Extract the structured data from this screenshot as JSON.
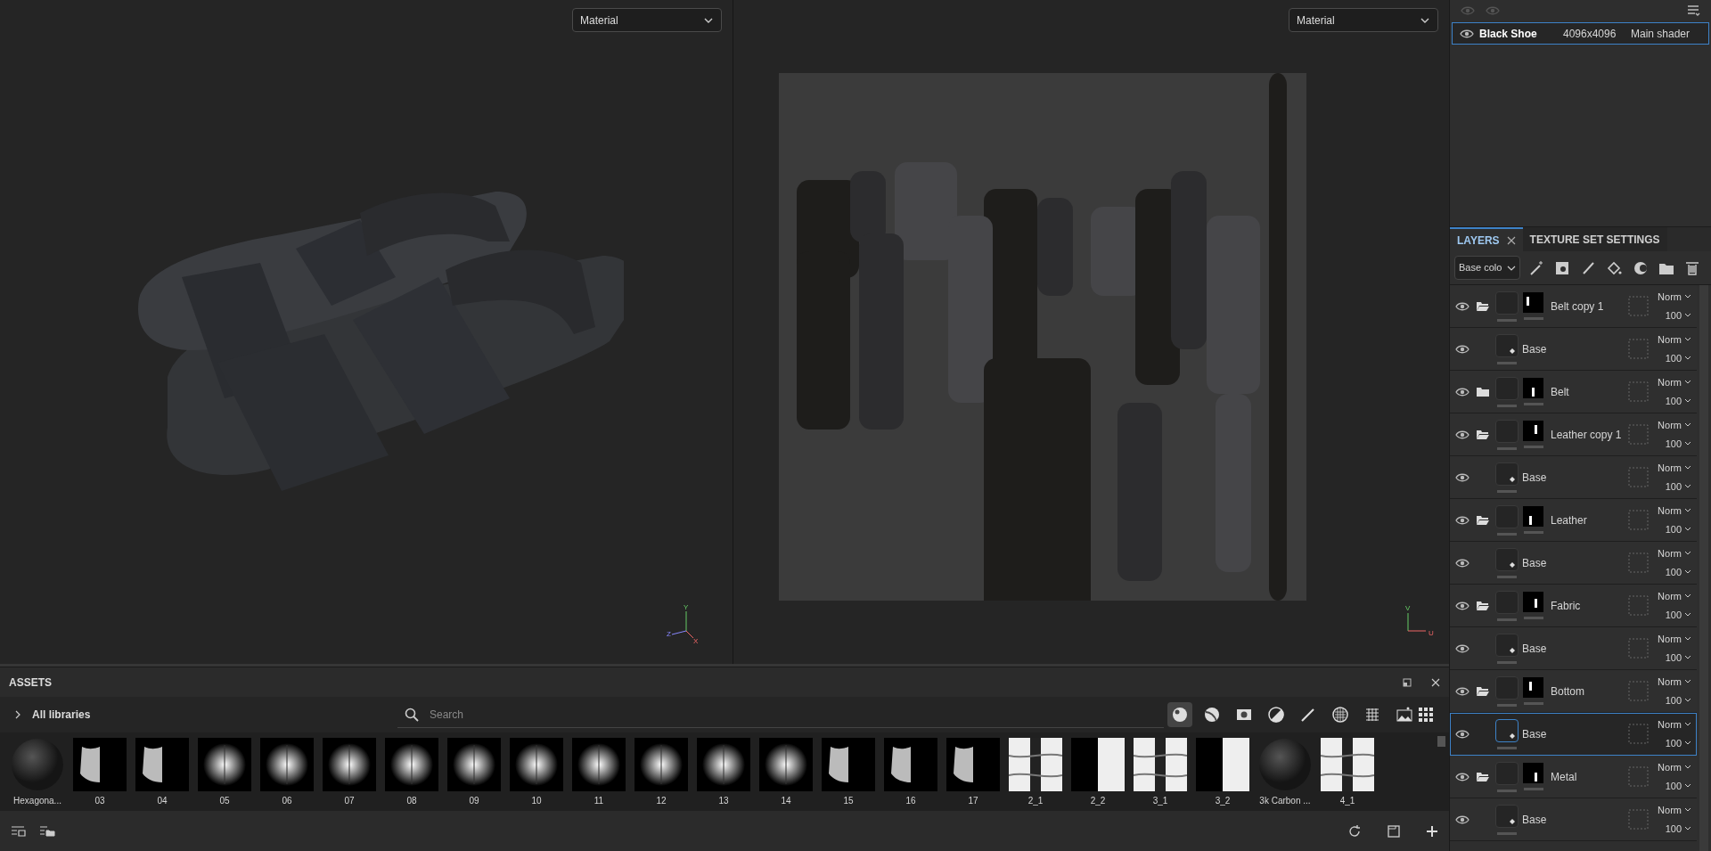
{
  "viewports": [
    {
      "dropdown": "Material",
      "gizmo": [
        "Y",
        "Z",
        "X"
      ]
    },
    {
      "dropdown": "Material",
      "gizmo": [
        "V",
        "U"
      ]
    }
  ],
  "texture_sets": [
    {
      "name": "Black Shoe",
      "resolution": "4096x4096",
      "shader": "Main shader",
      "selected": true,
      "visible": true
    }
  ],
  "tabs": [
    {
      "label": "LAYERS",
      "selected": true,
      "closable": true
    },
    {
      "label": "TEXTURE SET SETTINGS",
      "selected": false,
      "closable": false
    }
  ],
  "channel_dropdown": "Base colo",
  "layers": [
    {
      "name": "Belt copy 1",
      "kind": "folder",
      "expanded": true,
      "selected": false,
      "visible": true,
      "blend": "Norm",
      "opacity": "100"
    },
    {
      "name": "Base",
      "kind": "fill",
      "selected": false,
      "visible": true,
      "blend": "Norm",
      "opacity": "100"
    },
    {
      "name": "Belt",
      "kind": "folder",
      "expanded": false,
      "selected": false,
      "visible": true,
      "blend": "Norm",
      "opacity": "100"
    },
    {
      "name": "Leather copy 1",
      "kind": "folder",
      "expanded": true,
      "selected": false,
      "visible": true,
      "blend": "Norm",
      "opacity": "100"
    },
    {
      "name": "Base",
      "kind": "fill",
      "selected": false,
      "visible": true,
      "blend": "Norm",
      "opacity": "100"
    },
    {
      "name": "Leather",
      "kind": "folder",
      "expanded": true,
      "selected": false,
      "visible": true,
      "blend": "Norm",
      "opacity": "100"
    },
    {
      "name": "Base",
      "kind": "fill",
      "selected": false,
      "visible": true,
      "blend": "Norm",
      "opacity": "100"
    },
    {
      "name": "Fabric",
      "kind": "folder",
      "expanded": true,
      "selected": false,
      "visible": true,
      "blend": "Norm",
      "opacity": "100"
    },
    {
      "name": "Base",
      "kind": "fill",
      "selected": false,
      "visible": true,
      "blend": "Norm",
      "opacity": "100"
    },
    {
      "name": "Bottom",
      "kind": "folder",
      "expanded": true,
      "selected": false,
      "visible": true,
      "blend": "Norm",
      "opacity": "100"
    },
    {
      "name": "Base",
      "kind": "fill",
      "selected": true,
      "visible": true,
      "blend": "Norm",
      "opacity": "100"
    },
    {
      "name": "Metal",
      "kind": "folder",
      "expanded": true,
      "selected": false,
      "visible": true,
      "blend": "Norm",
      "opacity": "100"
    },
    {
      "name": "Base",
      "kind": "fill",
      "selected": false,
      "visible": true,
      "blend": "Norm",
      "opacity": "100"
    }
  ],
  "assets": {
    "title": "ASSETS",
    "library": "All libraries",
    "search": {
      "placeholder": "Search"
    },
    "filters": [
      {
        "selected": true
      },
      {
        "selected": false
      },
      {
        "selected": false
      },
      {
        "selected": false
      },
      {
        "selected": false
      },
      {
        "selected": false
      },
      {
        "selected": false
      },
      {
        "selected": false
      }
    ],
    "items": [
      {
        "label": "Hexagona...",
        "kind": "sphere"
      },
      {
        "label": "03",
        "kind": "edge"
      },
      {
        "label": "04",
        "kind": "edge"
      },
      {
        "label": "05",
        "kind": "blob"
      },
      {
        "label": "06",
        "kind": "blob"
      },
      {
        "label": "07",
        "kind": "blob"
      },
      {
        "label": "08",
        "kind": "blob"
      },
      {
        "label": "09",
        "kind": "blob"
      },
      {
        "label": "10",
        "kind": "blob"
      },
      {
        "label": "11",
        "kind": "blob"
      },
      {
        "label": "12",
        "kind": "blob"
      },
      {
        "label": "13",
        "kind": "blob"
      },
      {
        "label": "14",
        "kind": "blob"
      },
      {
        "label": "15",
        "kind": "edge"
      },
      {
        "label": "16",
        "kind": "edge"
      },
      {
        "label": "17",
        "kind": "edge"
      },
      {
        "label": "2_1",
        "kind": "strip"
      },
      {
        "label": "2_2",
        "kind": "half"
      },
      {
        "label": "3_1",
        "kind": "strip"
      },
      {
        "label": "3_2",
        "kind": "half"
      },
      {
        "label": "3k Carbon ...",
        "kind": "sphere"
      },
      {
        "label": "4_1",
        "kind": "strip"
      }
    ]
  }
}
